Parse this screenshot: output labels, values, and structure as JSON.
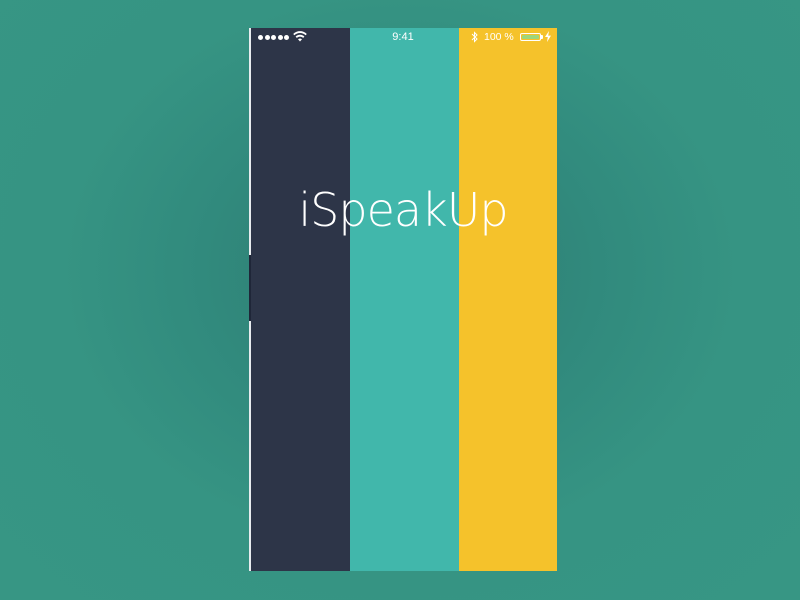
{
  "app": {
    "title": "iSpeakUp"
  },
  "status_bar": {
    "signal_bars": 5,
    "network_icon": "wifi-icon",
    "time": "9:41",
    "bluetooth_icon": "bluetooth-icon",
    "battery_percent_text": "100 %",
    "battery_level": 1.0,
    "charging_icon": "charging-bolt-icon"
  },
  "splash": {
    "stripe_colors": [
      "#2d3548",
      "#41b7ab",
      "#f5c22b"
    ]
  },
  "colors": {
    "background": "#318a7d",
    "text": "#ffffff",
    "battery_fill": "#9fd67b"
  }
}
